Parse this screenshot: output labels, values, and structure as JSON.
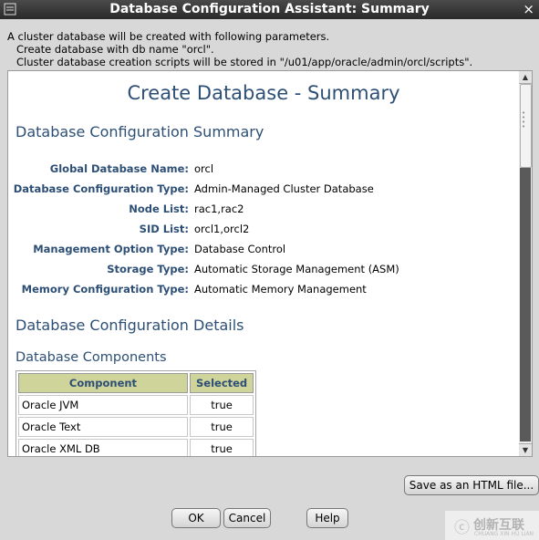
{
  "window": {
    "title": "Database Configuration Assistant: Summary",
    "close_glyph": "×"
  },
  "intro": {
    "line1": "A cluster database will be created with following parameters.",
    "line2": "Create database with db name \"orcl\".",
    "line3": "Cluster database creation scripts will be stored in \"/u01/app/oracle/admin/orcl/scripts\"."
  },
  "report": {
    "heading": "Create Database - Summary",
    "config_summary_title": "Database Configuration Summary",
    "params": [
      {
        "label": "Global Database Name:",
        "value": "orcl"
      },
      {
        "label": "Database Configuration Type:",
        "value": "Admin-Managed Cluster Database"
      },
      {
        "label": "Node List:",
        "value": "rac1,rac2"
      },
      {
        "label": "SID List:",
        "value": "orcl1,orcl2"
      },
      {
        "label": "Management Option Type:",
        "value": "Database Control"
      },
      {
        "label": "Storage Type:",
        "value": "Automatic Storage Management (ASM)"
      },
      {
        "label": "Memory Configuration Type:",
        "value": "Automatic Memory Management"
      }
    ],
    "config_details_title": "Database Configuration Details",
    "components_title": "Database Components",
    "components_table": {
      "headers": [
        "Component",
        "Selected"
      ],
      "rows": [
        [
          "Oracle JVM",
          "true"
        ],
        [
          "Oracle Text",
          "true"
        ],
        [
          "Oracle XML DB",
          "true"
        ]
      ]
    }
  },
  "buttons": {
    "save_html": "Save as an HTML file...",
    "ok": "OK",
    "cancel": "Cancel",
    "help": "Help"
  },
  "watermark": {
    "logo_glyph": "ⓒ",
    "text": "创新互联",
    "subtext": "CHUANG XIN HU LIAN"
  },
  "icons": {
    "window_menu": "window-menu-icon",
    "close": "close-icon",
    "scroll_up": "scroll-up-arrow-icon",
    "scroll_down": "scroll-down-arrow-icon"
  },
  "colors": {
    "heading": "#2d4f75",
    "table_header": "#cfd49a",
    "titlebar": "#333333"
  }
}
